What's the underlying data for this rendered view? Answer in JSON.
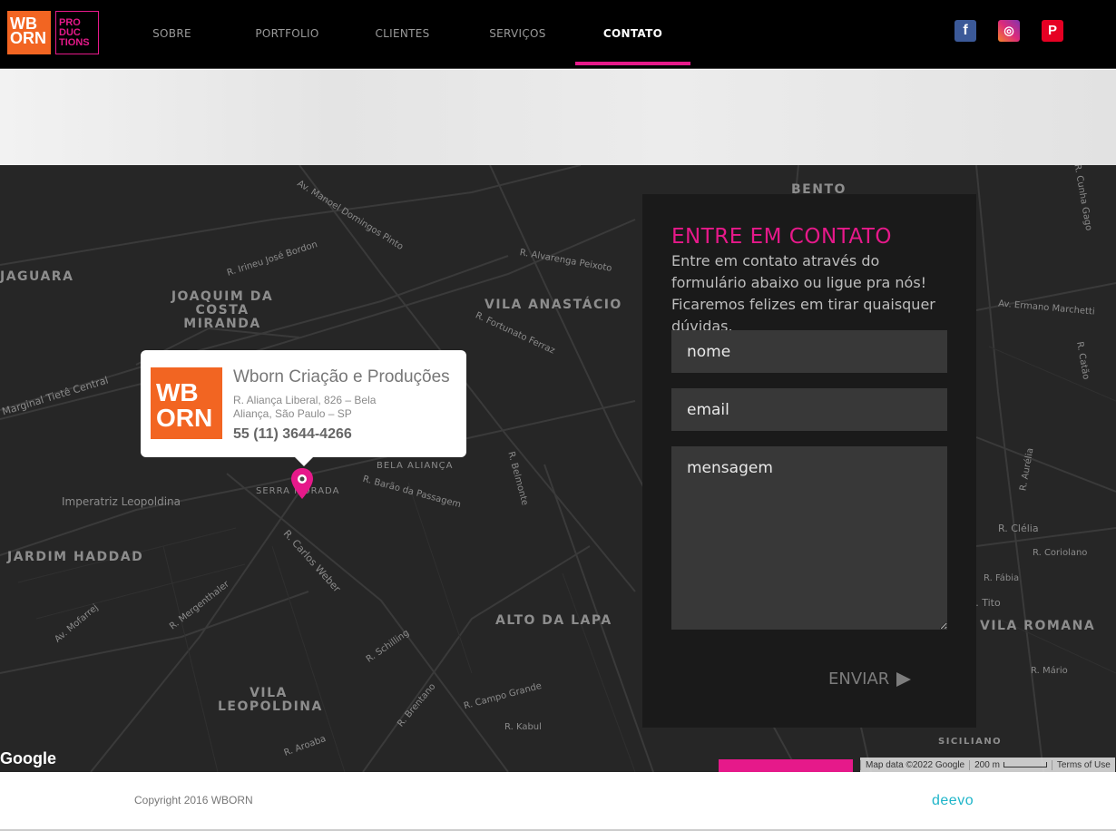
{
  "header": {
    "logo_wb": "WB ORN",
    "logo_prod": "PRO DUC TIONS",
    "nav": [
      {
        "label": "SOBRE",
        "active": false
      },
      {
        "label": "PORTFOLIO",
        "active": false
      },
      {
        "label": "CLIENTES",
        "active": false
      },
      {
        "label": "SERVIÇOS",
        "active": false
      },
      {
        "label": "CONTATO",
        "active": true
      }
    ],
    "social": [
      {
        "icon": "facebook-icon",
        "glyph": "f"
      },
      {
        "icon": "instagram-icon",
        "glyph": "◎"
      },
      {
        "icon": "pinterest-icon",
        "glyph": "P"
      }
    ]
  },
  "map": {
    "neighborhoods": [
      "JAGUARA",
      "JOAQUIM DA COSTA MIRANDA",
      "VILA ANASTÁCIO",
      "BENTO BICUDO II",
      "ALTO DA LAPA",
      "VILA LEOPOLDINA",
      "JARDIM HADDAD",
      "VILA ROMANA",
      "SICILIANO"
    ],
    "streets": [
      "Av. Manoel Domingos Pinto",
      "R. Irineu José Bordon",
      "Marginal Tietê Central",
      "R. Alvarenga Peixoto",
      "R. Fortunato Ferraz",
      "Imperatriz Leopoldina",
      "R. Barão da Passagem",
      "R. Carlos Weber",
      "R. Belmonte",
      "Av. Ermano Marchetti",
      "R. Schilling",
      "R. Brentano",
      "R. Campo Grande",
      "R. Clélia",
      "R. Tito",
      "R. Mário",
      "R. Fábia",
      "R. Coriolano",
      "R. Kabul",
      "R. Aroaba",
      "BELA ALIANÇA",
      "SERRA MORADA",
      "Av. Mofarrej",
      "R. Mergenthaler",
      "R. Cunha Gago",
      "R. Catão",
      "R. Aurélia"
    ],
    "info": {
      "logo": "WB ORN",
      "title": "Wborn Criação e Produções",
      "address": "R. Aliança Liberal, 826 – Bela Aliança, São Paulo – SP",
      "phone": "55 (11) 3644-4266"
    },
    "google": "Google",
    "map_data": "Map data ©2022 Google",
    "scale": "200 m",
    "terms": "Terms of Use"
  },
  "contact": {
    "title": "ENTRE EM CONTATO",
    "intro": "Entre em contato através do formulário abaixo ou ligue pra nós! Ficaremos felizes em tirar quaisquer dúvidas.",
    "name_placeholder": "nome",
    "email_placeholder": "email",
    "message_placeholder": "mensagem",
    "send_label": "ENVIAR"
  },
  "footer": {
    "copyright": "Copyright 2016 WBORN",
    "credit": "deevo"
  },
  "colors": {
    "accent": "#e6198a",
    "logo": "#f26522",
    "deevo": "#1fb5c9"
  }
}
